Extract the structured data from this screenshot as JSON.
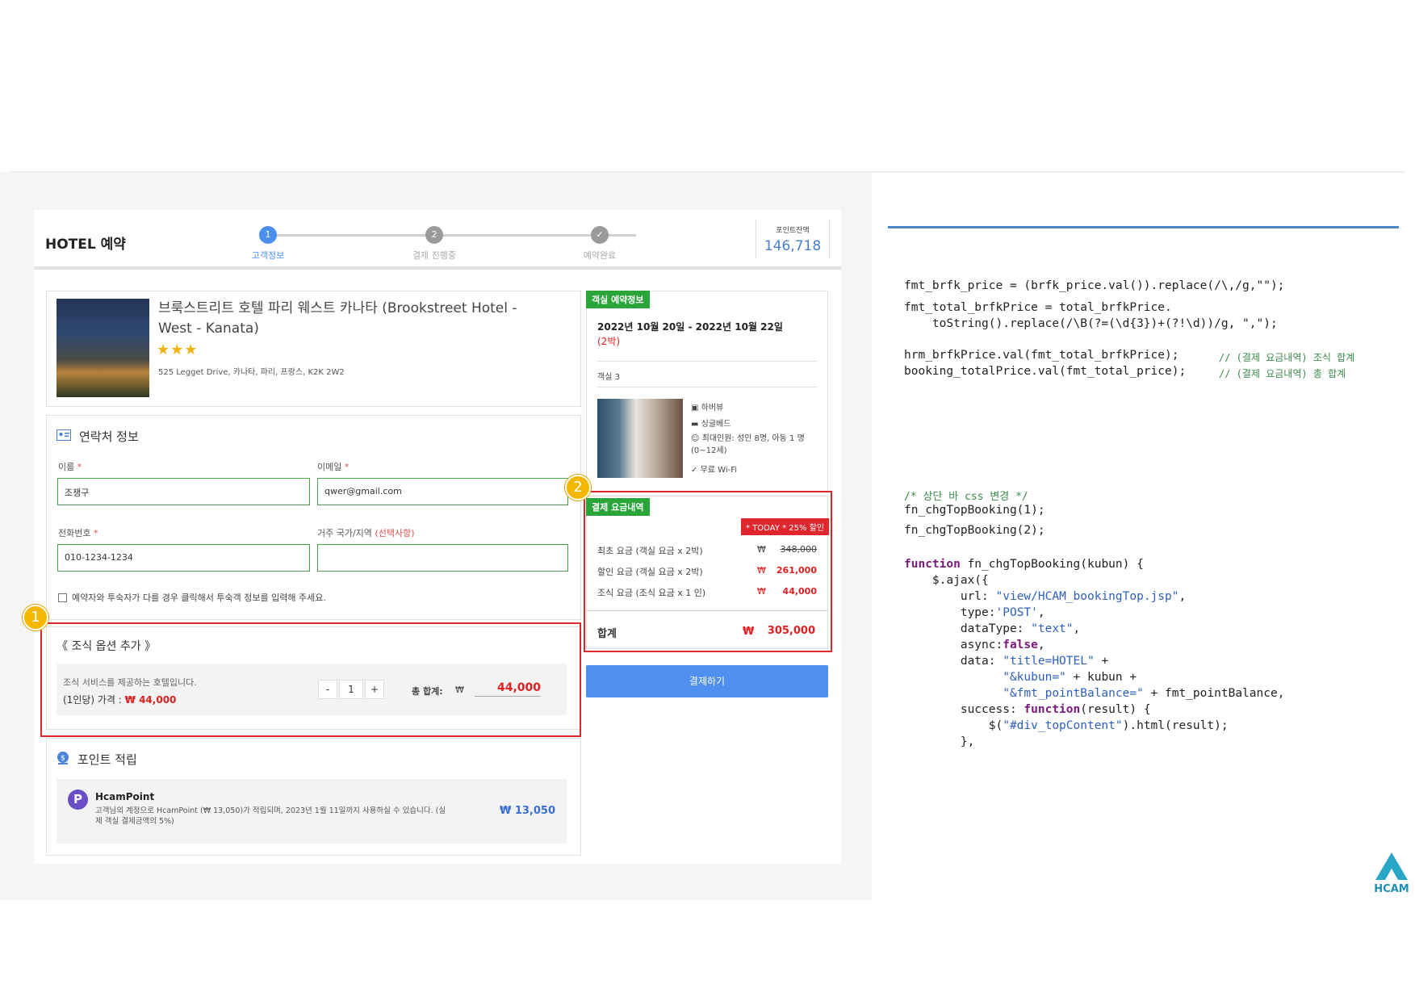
{
  "header": {
    "title": "HOTEL 예약",
    "steps": [
      {
        "num": "1",
        "label": "고객정보"
      },
      {
        "num": "2",
        "label": "결제 진행중"
      },
      {
        "num": "✓",
        "label": "예약완료"
      }
    ],
    "points_label": "포인트잔액",
    "points_value": "146,718"
  },
  "hotel": {
    "name": "브룩스트리트 호텔 파리 웨스트 카나타 (Brookstreet Hotel - West - Kanata)",
    "stars": "★★★",
    "address": "525 Legget Drive, 카나타, 파리, 프랑스, K2K 2W2"
  },
  "contact": {
    "title": "연락처 정보",
    "name_label": "이름",
    "name_value": "조쟁구",
    "email_label": "이메일",
    "email_value": "qwer@gmail.com",
    "phone_label": "전화번호",
    "phone_value": "010-1234-1234",
    "country_label": "거주 국가/지역",
    "country_optional": "(선택사항)",
    "country_value": "",
    "required_mark": "*",
    "checkbox_label": "예약자와 투숙자가 다를 경우 클릭해서 투숙객 정보를 입력해 주세요."
  },
  "breakfast": {
    "title": "《 조식 옵션 추가 》",
    "desc": "조식 서비스를 제공하는 호텔입니다.",
    "price_label": "(1인당) 가격 :",
    "price_value": "₩ 44,000",
    "minus": "-",
    "qty": "1",
    "plus": "+",
    "total_label": "총 합계:",
    "total_currency": "₩",
    "total_value": "44,000"
  },
  "points": {
    "title": "포인트 적립",
    "brand": "HcamPoint",
    "desc": "고객님의 계정으로 HcamPoint (₩ 13,050)가 적립되며, 2023년 1월 11일까지 사용하실 수 있습니다. (실제 객실 결제금액의 5%)",
    "value": "₩ 13,050"
  },
  "room": {
    "tag": "객실 예약정보",
    "dates": "2022년 10월 20일 - 2022년 10월 22일",
    "nights": "(2박)",
    "room_label": "객실 3",
    "features": [
      "하버뷰",
      "싱글베드",
      "최대인원: 성인 8명, 아동 1 명 (0~12세)",
      "무료 Wi-Fi"
    ]
  },
  "payment": {
    "tag": "결제 요금내역",
    "promo": "* TODAY * 25% 할인",
    "rows": [
      {
        "label": "최초 요금 (객실 요금 x 2박)",
        "currency": "₩",
        "value": "348,000"
      },
      {
        "label": "할인 요금 (객실 요금 x 2박)",
        "currency": "₩",
        "value": "261,000"
      },
      {
        "label": "조식 요금 (조식 요금 x 1 인)",
        "currency": "₩",
        "value": "44,000"
      }
    ],
    "total_label": "합계",
    "total_currency": "₩",
    "total_value": "305,000",
    "pay_button": "결제하기"
  },
  "annotations": {
    "badge1": "1",
    "badge2": "2"
  },
  "code": {
    "block1": [
      "fmt_brfk_price = (brfk_price.val()).replace(/\\,/g,\"\");",
      "fmt_total_brfkPrice = total_brfkPrice.",
      "    toString().replace(/\\B(?=(\\d{3})+(?!\\d))/g, \",\");",
      "hrm_brfkPrice.val(fmt_total_brfkPrice);",
      "booking_totalPrice.val(fmt_total_price);"
    ],
    "comment1": "// (결제 요금내역) 조식 합계",
    "comment2": "// (결제 요금내역) 총 합계",
    "block2_comment": "/* 상단 바 css 변경 */",
    "block2": [
      "fn_chgTopBooking(1);",
      "fn_chgTopBooking(2);"
    ],
    "fn_kw": "function",
    "fn_name": " fn_chgTopBooking(kubun) {",
    "ajax": "    $.ajax({",
    "url_key": "        url: ",
    "url_val": "\"view/HCAM_bookingTop.jsp\"",
    "type_key": "        type:",
    "type_val": "'POST'",
    "dtype_key": "        dataType: ",
    "dtype_val": "\"text\"",
    "async_key": "        async:",
    "async_val": "false",
    "data_key": "        data: ",
    "data_v1": "\"title=HOTEL\"",
    "data_v2": "\"&kubun=\"",
    "data_v2b": " + kubun +",
    "data_v3": "\"&fmt_pointBalance=\"",
    "data_v3b": " + fmt_pointBalance,",
    "succ_key": "        success: ",
    "succ_fn": "function",
    "succ_rest": "(result) {",
    "html_a": "            $(",
    "html_str": "\"#div_topContent\"",
    "html_b": ").html(result);",
    "close": "        },"
  },
  "logo_text": "HCAM"
}
